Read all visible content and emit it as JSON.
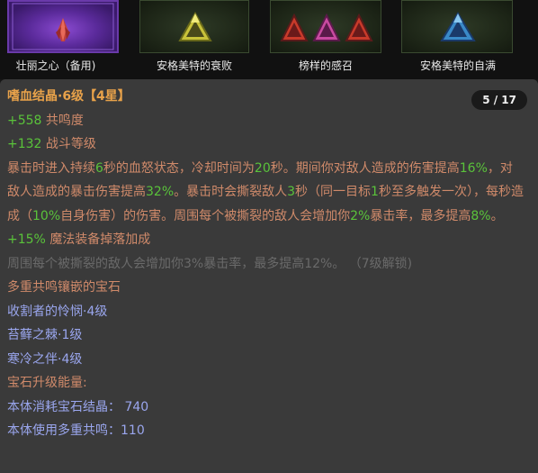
{
  "slots": [
    {
      "label": "壮丽之心（备用)",
      "icon": "red-crystal-icon"
    },
    {
      "label": "安格美特的衰败",
      "icon": "yellow-gem-icon"
    },
    {
      "label": "榜样的感召",
      "icon": "tri-gem-icon"
    },
    {
      "label": "安格美特的自满",
      "icon": "blue-gem-icon"
    }
  ],
  "tooltip": {
    "title": "嗜血结晶·6级",
    "stars": "【4星】",
    "counter": "5 / 17",
    "stats": [
      {
        "value": "+558",
        "name": "共鸣度"
      },
      {
        "value": "+132",
        "name": "战斗等级"
      }
    ],
    "description": {
      "p1": "暴击时进入持续",
      "n1": "6",
      "p2": "秒的血怒状态，冷却时间为",
      "n2": "20",
      "p3": "秒。期间你对敌人造成的伤害提高",
      "n3": "16%",
      "p4": "，对敌人造成的暴击伤害提高",
      "n4": "32%",
      "p5": "。暴击时会撕裂敌人",
      "n5": "3",
      "p6": "秒（同一目标",
      "n6": "1",
      "p7": "秒至多触发一次），每秒造成（",
      "n7": "10%",
      "p8": "自身伤害）的伤害。周围每个被撕裂的敌人会增加你",
      "n8": "2%",
      "p9": "暴击率，最多提高",
      "n9": "8%",
      "p10": "。"
    },
    "magic_find": {
      "value": "+15%",
      "name": "魔法装备掉落加成"
    },
    "locked_text": "周围每个被撕裂的敌人会增加你3%暴击率，最多提高12%。 （7级解锁)",
    "socket_header": "多重共鸣镶嵌的宝石",
    "socket_gems": [
      "收割者的怜悯·4级",
      "苔藓之棘·1级",
      "寒冷之伴·4级"
    ],
    "upgrade_header": "宝石升级能量:",
    "upgrade_lines": [
      {
        "label": "本体消耗宝石结晶：",
        "value": "740"
      },
      {
        "label": "本体使用多重共鸣：",
        "value": "110"
      }
    ]
  }
}
